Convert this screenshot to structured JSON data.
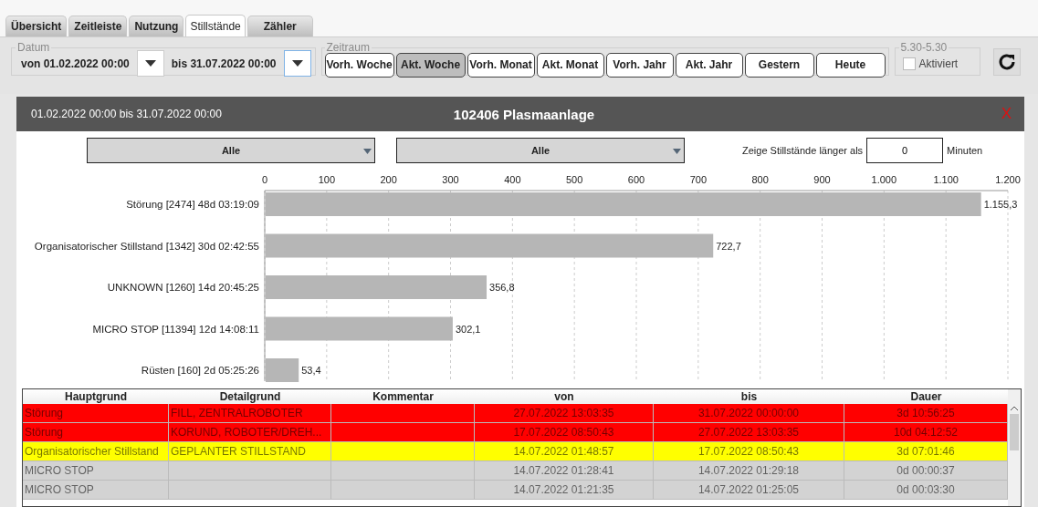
{
  "tabs": [
    {
      "label": "Übersicht",
      "selected": false
    },
    {
      "label": "Zeitleiste",
      "selected": false
    },
    {
      "label": "Nutzung",
      "selected": false
    },
    {
      "label": "Stillstände",
      "selected": true
    },
    {
      "label": "Zähler",
      "selected": false
    }
  ],
  "date_group": {
    "legend": "Datum",
    "from": "von 01.02.2022 00:00",
    "to": "bis 31.07.2022 00:00"
  },
  "period_group": {
    "legend": "Zeitraum",
    "buttons": [
      {
        "label": "Vorh. Woche",
        "selected": false
      },
      {
        "label": "Akt. Woche",
        "selected": true
      },
      {
        "label": "Vorh. Monat",
        "selected": false
      },
      {
        "label": "Akt. Monat",
        "selected": false
      },
      {
        "label": "Vorh. Jahr",
        "selected": false
      },
      {
        "label": "Akt. Jahr",
        "selected": false
      },
      {
        "label": "Gestern",
        "selected": false
      },
      {
        "label": "Heute",
        "selected": false
      }
    ]
  },
  "shift_group": {
    "legend": "5.30-5.30",
    "checkbox": {
      "label": "Aktiviert",
      "checked": false
    }
  },
  "panel": {
    "range": "01.02.2022 00:00 bis 31.07.2022 00:00",
    "title": "102406 Plasmaanlage",
    "close": "X",
    "filter_1": "Alle",
    "filter_2": "Alle",
    "min_label": "Zeige Stillstände länger als",
    "min_value": "0",
    "min_unit": "Minuten",
    "chart_data": {
      "type": "bar",
      "orientation": "horizontal",
      "categories": [
        "Störung [2474] 48d 03:19:09",
        "Organisatorischer Stillstand [1342] 30d 02:42:55",
        "UNKNOWN [1260] 14d 20:45:25",
        "MICRO STOP [11394] 12d 14:08:11",
        "Rüsten [160] 2d 05:25:26"
      ],
      "values": [
        1155.3,
        722.7,
        356.8,
        302.1,
        53.4
      ],
      "value_labels": [
        "1.155,3",
        "722,7",
        "356,8",
        "302,1",
        "53,4"
      ],
      "xlim": [
        0,
        1200
      ],
      "grid": true,
      "xticks": [
        0,
        100,
        200,
        300,
        400,
        500,
        600,
        700,
        800,
        900,
        {
          "value": 1000,
          "label": "1.000"
        },
        {
          "value": 1100,
          "label": "1.100"
        },
        {
          "value": 1200,
          "label": "1.200"
        }
      ]
    },
    "table": {
      "columns": [
        "Hauptgrund",
        "Detailgrund",
        "Kommentar",
        "von",
        "bis",
        "Dauer"
      ],
      "rows": [
        {
          "color": "#ff0000",
          "cells": [
            "Störung",
            "FILL, ZENTRALROBOTER",
            "",
            "27.07.2022 13:03:35",
            "31.07.2022 00:00:00",
            "3d 10:56:25"
          ]
        },
        {
          "color": "#ff0000",
          "cells": [
            "Störung",
            "KORUND, ROBOTER/DREH...",
            "",
            "17.07.2022 08:50:43",
            "27.07.2022 13:03:35",
            "10d 04:12:52"
          ]
        },
        {
          "color": "#ffff00",
          "cells": [
            "Organisatorischer Stillstand",
            "GEPLANTER STILLSTAND",
            "",
            "14.07.2022 01:48:57",
            "17.07.2022 08:50:43",
            "3d 07:01:46"
          ]
        },
        {
          "color": "#d3d3d3",
          "cells": [
            "MICRO STOP",
            "",
            "",
            "14.07.2022 01:28:41",
            "14.07.2022 01:29:18",
            "0d 00:00:37"
          ]
        },
        {
          "color": "#d3d3d3",
          "cells": [
            "MICRO STOP",
            "",
            "",
            "14.07.2022 01:21:35",
            "14.07.2022 01:25:05",
            "0d 00:03:30"
          ]
        }
      ]
    }
  }
}
